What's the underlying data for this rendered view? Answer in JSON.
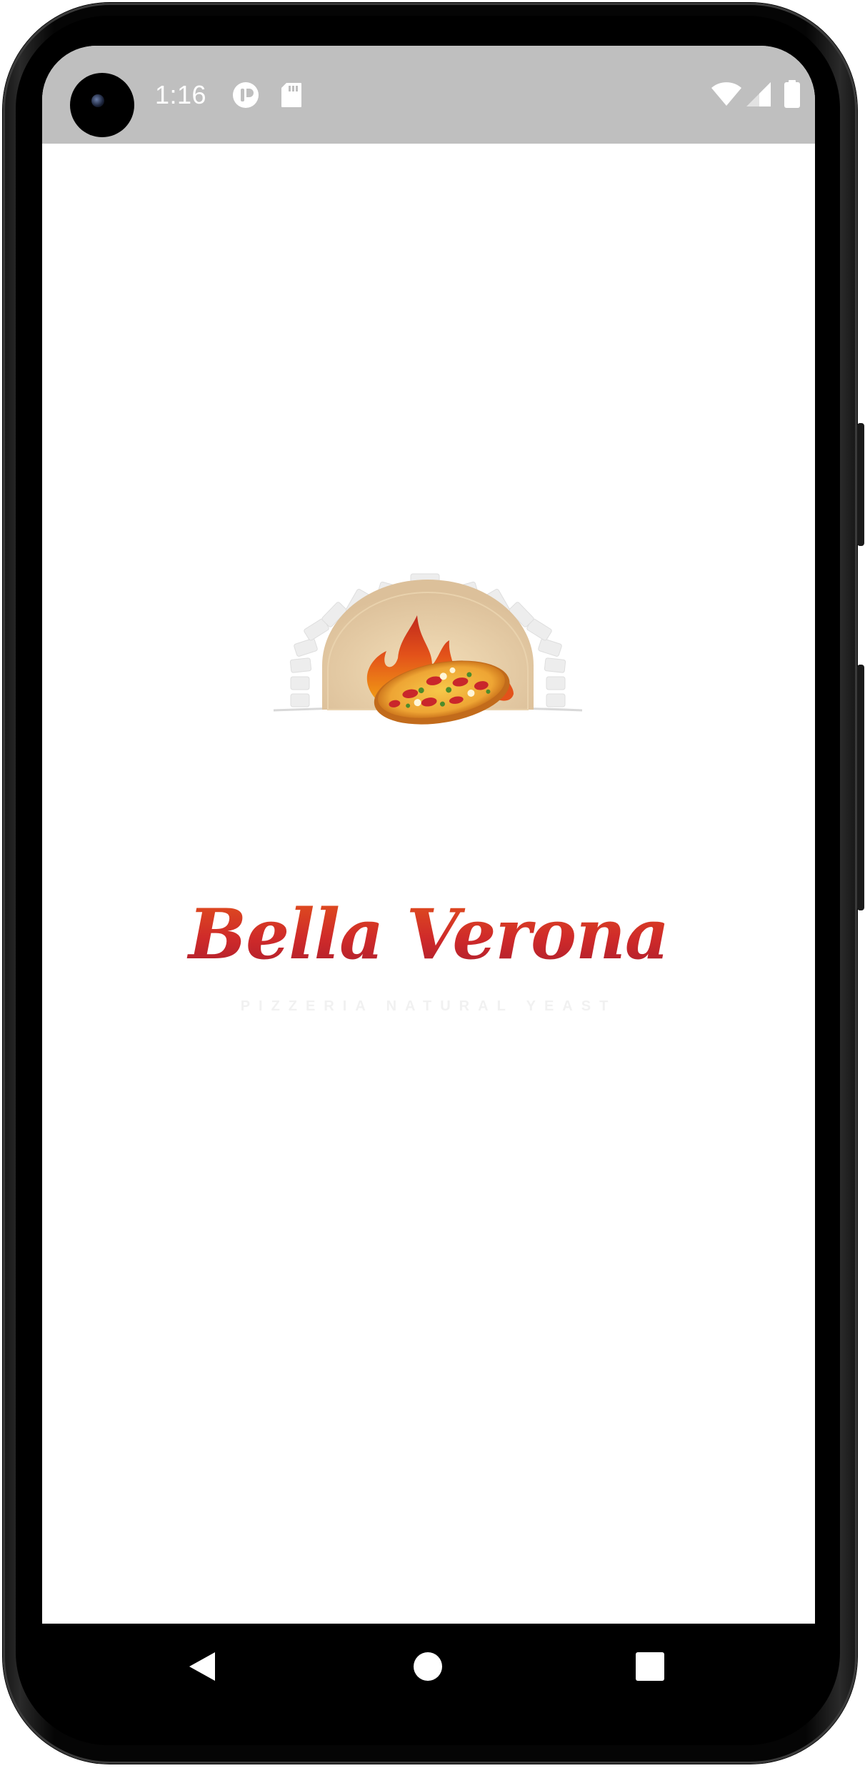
{
  "status_bar": {
    "time": "1:16",
    "icons": [
      "notification-app-icon",
      "sd-card-icon",
      "wifi-icon",
      "cellular-signal-icon",
      "battery-icon"
    ]
  },
  "splash": {
    "brand_name": "Bella Verona",
    "tagline": "PIZZERIA NATURAL YEAST",
    "logo": "brick-oven-pizza-logo"
  },
  "navigation_bar": {
    "buttons": [
      "back",
      "home",
      "recents"
    ]
  },
  "colors": {
    "status_bar_bg": "#bfbfbf",
    "screen_bg": "#ffffff",
    "brand_red": "#c1272d",
    "brand_orange": "#e2531c",
    "phone_frame": "#050505"
  }
}
